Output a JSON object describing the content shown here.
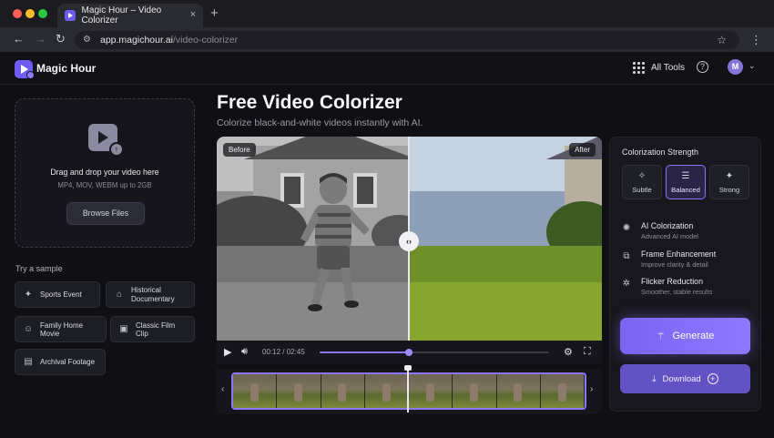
{
  "browser": {
    "tab_title": "Magic Hour – Video Colorizer",
    "tab_close": "×",
    "new_tab": "+",
    "url_host": "app.magichour.ai",
    "url_path": "/video-colorizer",
    "traffic_colors": [
      "#ff5f57",
      "#febc2e",
      "#28c840"
    ]
  },
  "header": {
    "brand": "Magic Hour",
    "all_tools": "All Tools",
    "help": "?",
    "avatar_initial": "M"
  },
  "upload": {
    "title": "Drag and drop your video here",
    "formats": "MP4, MOV, WEBM up to 2GB",
    "browse_label": "Browse Files"
  },
  "samples": {
    "heading": "Try a sample",
    "items": [
      {
        "label": "Sports Event",
        "icon": "runner-icon"
      },
      {
        "label": "Historical Documentary",
        "icon": "museum-icon"
      },
      {
        "label": "Family Home Movie",
        "icon": "people-icon"
      },
      {
        "label": "Classic Film Clip",
        "icon": "film-icon"
      },
      {
        "label": "Archival Footage",
        "icon": "archive-icon"
      }
    ]
  },
  "main": {
    "title": "Free Video Colorizer",
    "subtitle": "Colorize black-and-white videos instantly with AI."
  },
  "player": {
    "before_label": "Before",
    "after_label": "After",
    "time": "00:12 / 02:45",
    "progress_percent": 39,
    "handle_glyph": "‹›"
  },
  "strength": {
    "title": "Colorization Strength",
    "options": [
      {
        "label": "Subtle",
        "icon": "sparkle-small-icon",
        "active": false
      },
      {
        "label": "Balanced",
        "icon": "sliders-icon",
        "active": true
      },
      {
        "label": "Strong",
        "icon": "sparkle-large-icon",
        "active": false
      }
    ]
  },
  "features": [
    {
      "name": "AI Colorization",
      "desc": "Advanced AI model",
      "icon": "brain-icon"
    },
    {
      "name": "Frame Enhancement",
      "desc": "Improve clarity & detail",
      "icon": "frame-icon"
    },
    {
      "name": "Flicker Reduction",
      "desc": "Smoother, stable results",
      "icon": "sparkle-icon"
    }
  ],
  "actions": {
    "generate_label": "Generate",
    "download_label": "Download"
  },
  "colors": {
    "accent": "#8a77ff",
    "background": "#0f0f14",
    "panel": "#17171d"
  }
}
